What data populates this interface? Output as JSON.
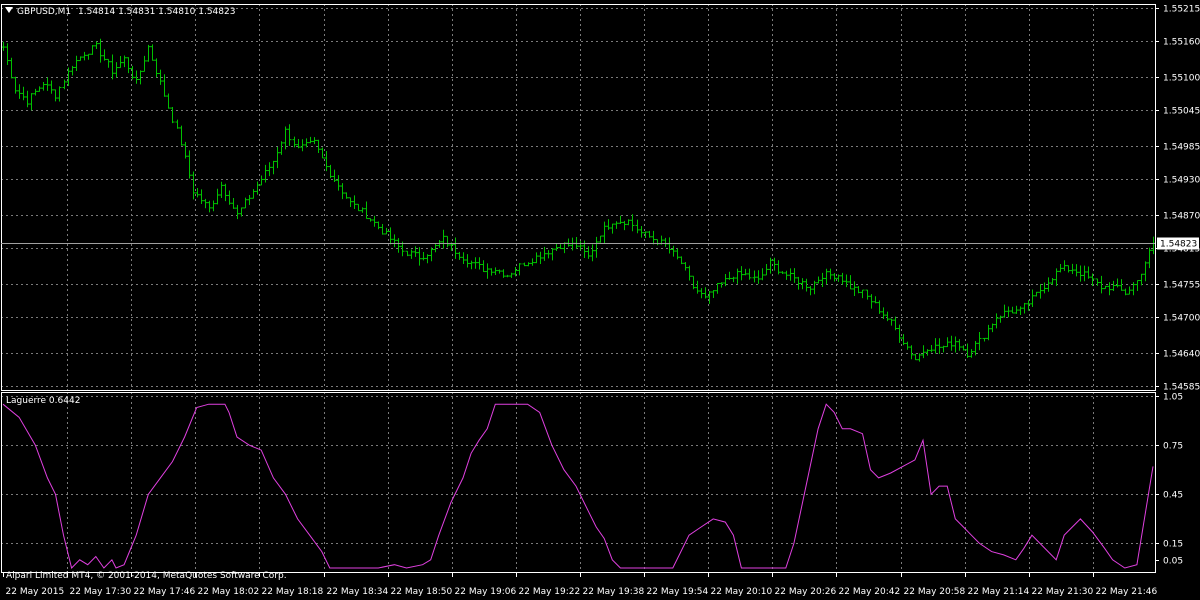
{
  "header": {
    "symbol": "GBPUSD,M1",
    "ohlc": "1.54814 1.54831 1.54810 1.54823",
    "arrow_icon": "triangle-down-icon"
  },
  "indicator": {
    "label": "Laguerre 0.6442"
  },
  "footer": {
    "copyright": "Alpari Limited MT4, © 2001-2014, MetaQuotes Software Corp."
  },
  "colors": {
    "background": "#000000",
    "bars": "#00c000",
    "indicator_line": "#e040e0",
    "grid": "#7a7a7a",
    "text": "#ffffff",
    "price_line": "#a0a0a0",
    "price_badge_bg": "#ffffff",
    "price_badge_text": "#000000"
  },
  "chart_data": [
    {
      "type": "ohlc",
      "ylim": [
        1.54585,
        1.55215
      ],
      "y_ticks": [
        "1.55215",
        "1.55160",
        "1.55100",
        "1.55045",
        "1.54985",
        "1.54930",
        "1.54870",
        "1.54815",
        "1.54755",
        "1.54700",
        "1.54640",
        "1.54585"
      ],
      "current_price": "1.54823",
      "x_labels": [
        "22 May 2015",
        "22 May 17:30",
        "22 May 17:46",
        "22 May 18:02",
        "22 May 18:18",
        "22 May 18:34",
        "22 May 18:50",
        "22 May 19:06",
        "22 May 19:22",
        "22 May 19:38",
        "22 May 19:54",
        "22 May 20:10",
        "22 May 20:26",
        "22 May 20:42",
        "22 May 20:58",
        "22 May 21:14",
        "22 May 21:30",
        "22 May 21:46"
      ],
      "close_anchors": [
        [
          0,
          1.5515
        ],
        [
          3,
          1.5508
        ],
        [
          6,
          1.5506
        ],
        [
          10,
          1.5509
        ],
        [
          13,
          1.5507
        ],
        [
          17,
          1.5512
        ],
        [
          20,
          1.5514
        ],
        [
          23,
          1.5515
        ],
        [
          27,
          1.5511
        ],
        [
          30,
          1.5513
        ],
        [
          33,
          1.5509
        ],
        [
          36,
          1.5515
        ],
        [
          38,
          1.5511
        ],
        [
          41,
          1.5505
        ],
        [
          44,
          1.5499
        ],
        [
          47,
          1.5491
        ],
        [
          51,
          1.5488
        ],
        [
          54,
          1.5492
        ],
        [
          58,
          1.5487
        ],
        [
          61,
          1.549
        ],
        [
          64,
          1.5493
        ],
        [
          67,
          1.5496
        ],
        [
          70,
          1.5501
        ],
        [
          73,
          1.5498
        ],
        [
          77,
          1.5499
        ],
        [
          80,
          1.5495
        ],
        [
          83,
          1.5492
        ],
        [
          86,
          1.5489
        ],
        [
          90,
          1.5487
        ],
        [
          93,
          1.5485
        ],
        [
          96,
          1.5483
        ],
        [
          99,
          1.5481
        ],
        [
          103,
          1.548
        ],
        [
          106,
          1.5481
        ],
        [
          109,
          1.5483
        ],
        [
          112,
          1.5481
        ],
        [
          116,
          1.5479
        ],
        [
          119,
          1.5478
        ],
        [
          122,
          1.5478
        ],
        [
          125,
          1.5477
        ],
        [
          129,
          1.5479
        ],
        [
          132,
          1.548
        ],
        [
          135,
          1.5481
        ],
        [
          138,
          1.5482
        ],
        [
          142,
          1.5482
        ],
        [
          145,
          1.548
        ],
        [
          148,
          1.5484
        ],
        [
          151,
          1.5486
        ],
        [
          155,
          1.5486
        ],
        [
          158,
          1.5484
        ],
        [
          161,
          1.5483
        ],
        [
          164,
          1.5482
        ],
        [
          168,
          1.5479
        ],
        [
          171,
          1.5475
        ],
        [
          174,
          1.5473
        ],
        [
          177,
          1.5475
        ],
        [
          181,
          1.5477
        ],
        [
          184,
          1.5477
        ],
        [
          187,
          1.5476
        ],
        [
          190,
          1.5479
        ],
        [
          194,
          1.5477
        ],
        [
          197,
          1.5476
        ],
        [
          200,
          1.5475
        ],
        [
          203,
          1.5477
        ],
        [
          207,
          1.5477
        ],
        [
          210,
          1.5475
        ],
        [
          213,
          1.5474
        ],
        [
          216,
          1.5472
        ],
        [
          220,
          1.5469
        ],
        [
          223,
          1.5466
        ],
        [
          226,
          1.5463
        ],
        [
          229,
          1.5465
        ],
        [
          233,
          1.5465
        ],
        [
          236,
          1.5466
        ],
        [
          239,
          1.5464
        ],
        [
          242,
          1.5466
        ],
        [
          246,
          1.547
        ],
        [
          249,
          1.5471
        ],
        [
          252,
          1.5471
        ],
        [
          255,
          1.5473
        ],
        [
          259,
          1.5476
        ],
        [
          262,
          1.5478
        ],
        [
          265,
          1.5478
        ],
        [
          268,
          1.5477
        ],
        [
          272,
          1.5475
        ],
        [
          275,
          1.5475
        ],
        [
          278,
          1.5474
        ],
        [
          281,
          1.5476
        ],
        [
          285,
          1.54823
        ]
      ],
      "bar_count": 286
    },
    {
      "type": "line",
      "name": "Laguerre 0.6442",
      "ylim": [
        0,
        1.05
      ],
      "y_ticks": [
        "1.05",
        "0.75",
        "0.45",
        "0.15",
        "0.05"
      ],
      "points": [
        [
          0,
          1.0
        ],
        [
          4,
          0.92
        ],
        [
          8,
          0.75
        ],
        [
          11,
          0.55
        ],
        [
          13,
          0.45
        ],
        [
          15,
          0.2
        ],
        [
          17,
          0.0
        ],
        [
          19,
          0.05
        ],
        [
          21,
          0.02
        ],
        [
          23,
          0.07
        ],
        [
          25,
          0.0
        ],
        [
          27,
          0.05
        ],
        [
          28,
          0.0
        ],
        [
          30,
          0.02
        ],
        [
          33,
          0.2
        ],
        [
          36,
          0.45
        ],
        [
          39,
          0.55
        ],
        [
          42,
          0.65
        ],
        [
          45,
          0.8
        ],
        [
          48,
          0.98
        ],
        [
          51,
          1.0
        ],
        [
          55,
          1.0
        ],
        [
          56,
          0.95
        ],
        [
          58,
          0.8
        ],
        [
          61,
          0.75
        ],
        [
          64,
          0.72
        ],
        [
          67,
          0.55
        ],
        [
          70,
          0.45
        ],
        [
          73,
          0.3
        ],
        [
          76,
          0.2
        ],
        [
          79,
          0.1
        ],
        [
          81,
          0.0
        ],
        [
          85,
          0.0
        ],
        [
          89,
          0.0
        ],
        [
          93,
          0.0
        ],
        [
          97,
          0.02
        ],
        [
          100,
          0.0
        ],
        [
          104,
          0.02
        ],
        [
          106,
          0.05
        ],
        [
          108,
          0.2
        ],
        [
          111,
          0.4
        ],
        [
          114,
          0.55
        ],
        [
          116,
          0.7
        ],
        [
          118,
          0.78
        ],
        [
          120,
          0.85
        ],
        [
          122,
          1.0
        ],
        [
          125,
          1.0
        ],
        [
          130,
          1.0
        ],
        [
          133,
          0.95
        ],
        [
          136,
          0.75
        ],
        [
          139,
          0.6
        ],
        [
          142,
          0.5
        ],
        [
          145,
          0.35
        ],
        [
          147,
          0.25
        ],
        [
          149,
          0.18
        ],
        [
          151,
          0.05
        ],
        [
          153,
          0.0
        ],
        [
          158,
          0.0
        ],
        [
          162,
          0.0
        ],
        [
          166,
          0.0
        ],
        [
          168,
          0.1
        ],
        [
          170,
          0.2
        ],
        [
          173,
          0.25
        ],
        [
          176,
          0.3
        ],
        [
          179,
          0.28
        ],
        [
          181,
          0.2
        ],
        [
          183,
          0.0
        ],
        [
          190,
          0.0
        ],
        [
          194,
          0.0
        ],
        [
          196,
          0.15
        ],
        [
          199,
          0.5
        ],
        [
          202,
          0.85
        ],
        [
          204,
          1.0
        ],
        [
          206,
          0.95
        ],
        [
          208,
          0.85
        ],
        [
          210,
          0.85
        ],
        [
          213,
          0.82
        ],
        [
          215,
          0.6
        ],
        [
          217,
          0.55
        ],
        [
          220,
          0.58
        ],
        [
          223,
          0.62
        ],
        [
          226,
          0.66
        ],
        [
          228,
          0.78
        ],
        [
          230,
          0.45
        ],
        [
          232,
          0.5
        ],
        [
          234,
          0.5
        ],
        [
          236,
          0.3
        ],
        [
          238,
          0.25
        ],
        [
          240,
          0.2
        ],
        [
          242,
          0.15
        ],
        [
          245,
          0.1
        ],
        [
          248,
          0.08
        ],
        [
          251,
          0.05
        ],
        [
          253,
          0.12
        ],
        [
          255,
          0.2
        ],
        [
          257,
          0.15
        ],
        [
          259,
          0.1
        ],
        [
          261,
          0.05
        ],
        [
          263,
          0.2
        ],
        [
          265,
          0.25
        ],
        [
          267,
          0.3
        ],
        [
          270,
          0.22
        ],
        [
          273,
          0.12
        ],
        [
          275,
          0.05
        ],
        [
          278,
          0.0
        ],
        [
          281,
          0.02
        ],
        [
          285,
          0.62
        ]
      ]
    }
  ]
}
